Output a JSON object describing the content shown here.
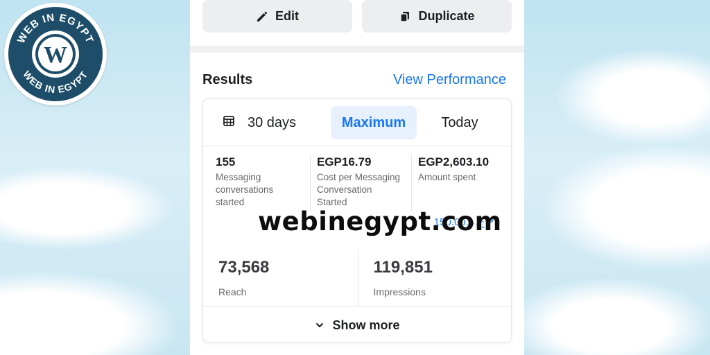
{
  "logo": {
    "text_top": "WEB IN EGYPT",
    "text_bottom": "WEB IN EGYPT",
    "letter": "W",
    "colors": {
      "ring": "#1d4d68",
      "inner": "#ffffff",
      "letter": "#1d4d68"
    }
  },
  "actions": {
    "edit_label": "Edit",
    "edit_icon": "pencil-icon",
    "duplicate_label": "Duplicate",
    "duplicate_icon": "copy-icon"
  },
  "results": {
    "title": "Results",
    "view_performance": "View Performance"
  },
  "date_range": {
    "calendar_icon": "calendar-icon",
    "options": [
      "30 days",
      "Maximum",
      "Today"
    ],
    "selected": "Maximum"
  },
  "metrics": [
    {
      "value": "155",
      "label": "Messaging conversations started"
    },
    {
      "value": "EGP16.79",
      "label": "Cost per Messaging Conversation Started"
    },
    {
      "value": "EGP2,603.10",
      "label": "Amount spent"
    }
  ],
  "budget": {
    "text": "ج.م.150.00",
    "icon": "pencil-icon"
  },
  "reach": {
    "value": "73,568",
    "label": "Reach"
  },
  "impressions": {
    "value": "119,851",
    "label": "Impressions"
  },
  "show_more": {
    "label": "Show more",
    "icon": "chevron-down-icon"
  },
  "watermark": "webinegypt.com",
  "colors": {
    "accent": "#1877f2",
    "selected_bg": "#e7f0fd",
    "button_bg": "#edeef0",
    "text": "#1c1e21",
    "secondary_text": "#65676b"
  }
}
